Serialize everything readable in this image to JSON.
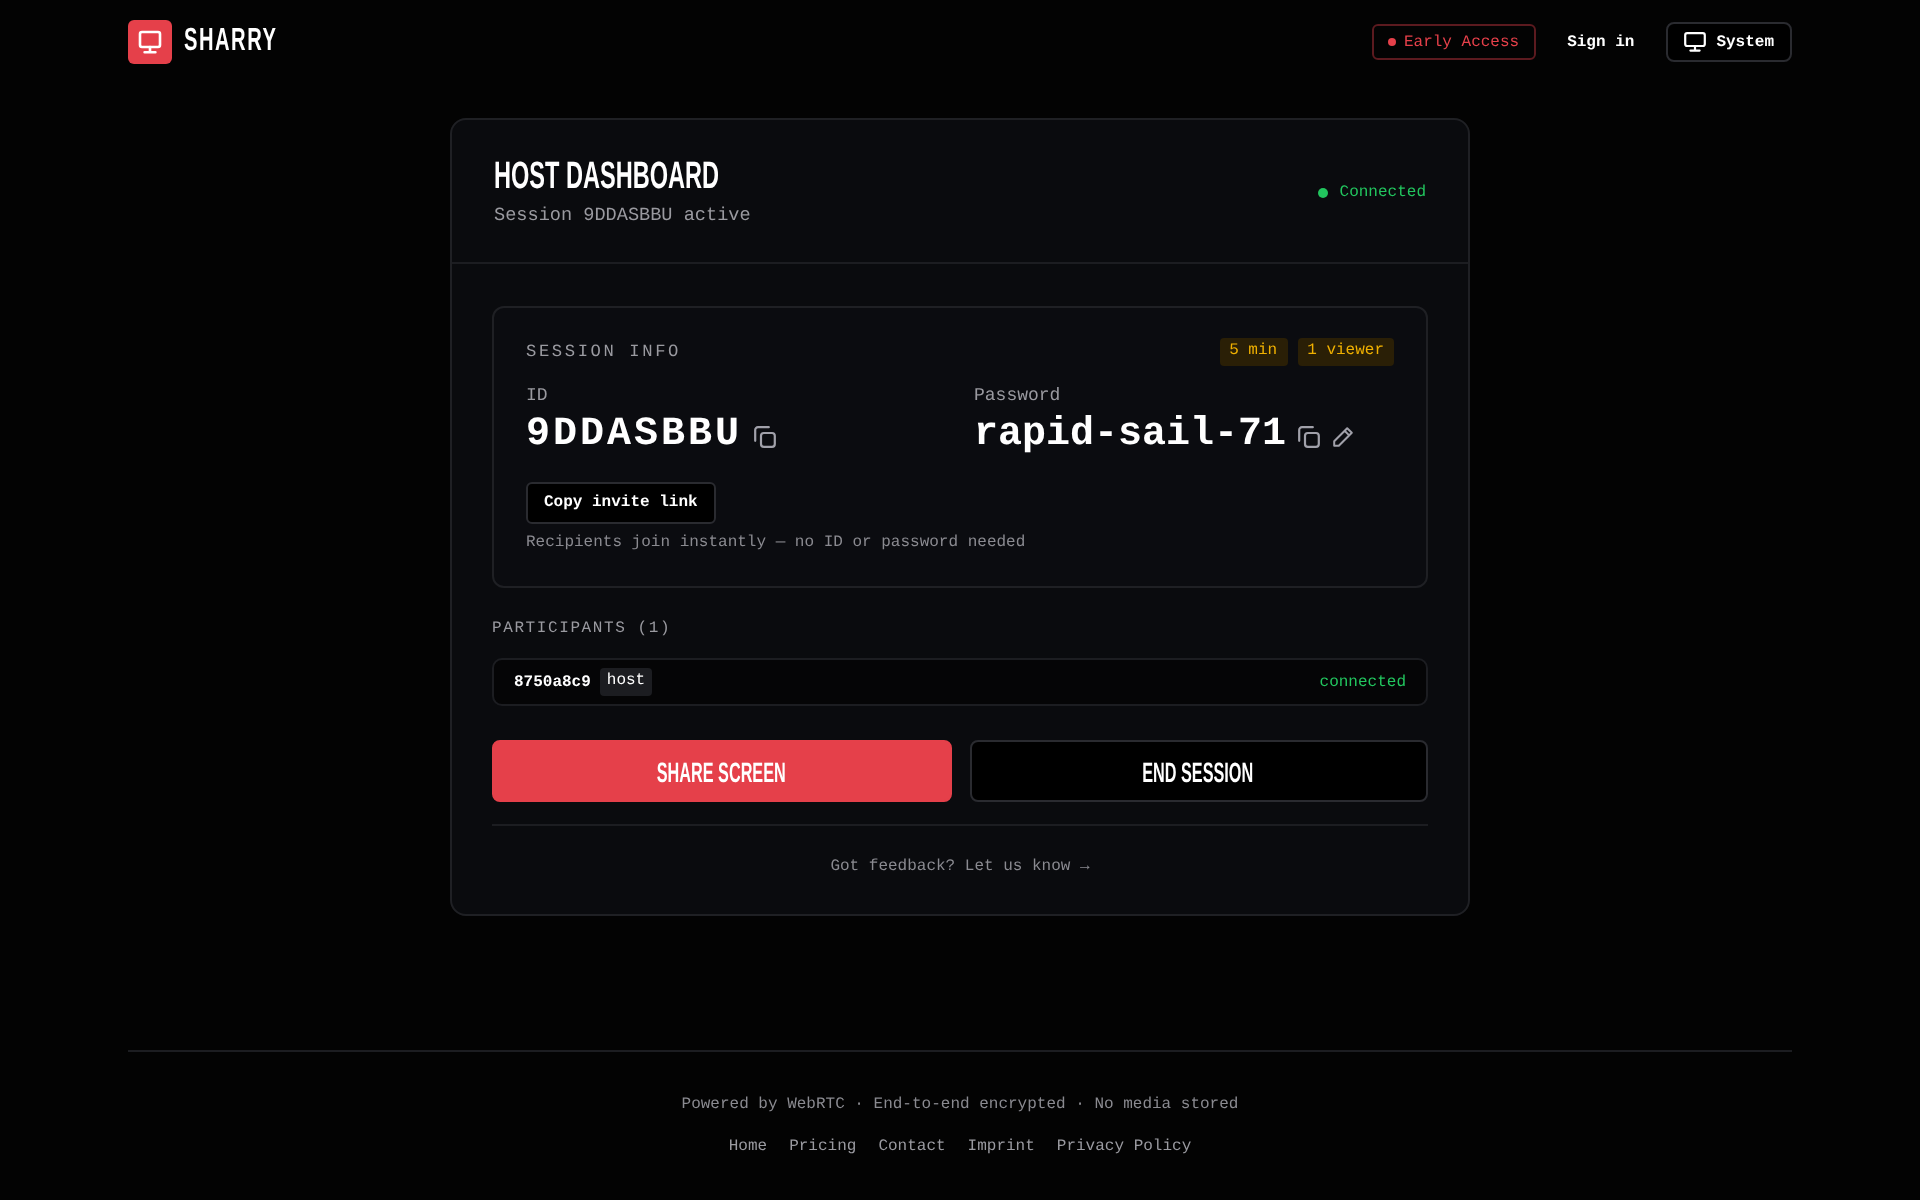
{
  "header": {
    "brand": "SHARRY",
    "badge": "Early Access",
    "sign_in": "Sign in",
    "theme_button": "System"
  },
  "dashboard": {
    "title": "HOST DASHBOARD",
    "subtitle": "Session 9DDASBBU active",
    "status": {
      "label": "Connected",
      "online": true
    }
  },
  "session_info": {
    "heading": "SESSION INFO",
    "badges": [
      "5 min",
      "1 viewer"
    ],
    "fields": [
      {
        "label": "ID",
        "value": "9DDASBBU",
        "tools": [
          {
            "kind": "copy"
          }
        ]
      },
      {
        "label": "Password",
        "value": "rapid-sail-71",
        "tools": [
          {
            "kind": "copy"
          },
          {
            "kind": "edit"
          }
        ]
      }
    ],
    "invite_button": "Copy invite link",
    "hint": "Recipients join instantly — no ID or password needed"
  },
  "participants": {
    "heading": "PARTICIPANTS (1)",
    "items": [
      {
        "id": "8750a8c9",
        "role": "host",
        "status": "connected",
        "online": true
      }
    ]
  },
  "actions": [
    {
      "label": "SHARE SCREEN",
      "kind": "primary"
    },
    {
      "label": "END SESSION",
      "kind": "secondary"
    }
  ],
  "feedback": "Got feedback? Let us know →",
  "footer": {
    "tagline": "Powered by WebRTC · End-to-end encrypted · No media stored",
    "links": [
      "Home",
      "Pricing",
      "Contact",
      "Imprint",
      "Privacy Policy"
    ]
  }
}
